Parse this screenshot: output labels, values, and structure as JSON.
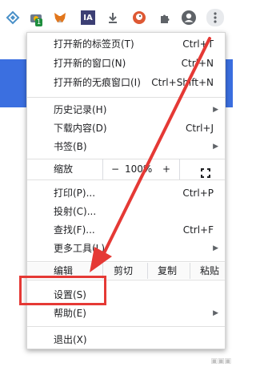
{
  "menu": {
    "items": [
      {
        "label": "打开新的标签页(T)",
        "shortcut": "Ctrl+T"
      },
      {
        "label": "打开新的窗口(N)",
        "shortcut": "Ctrl+N"
      },
      {
        "label": "打开新的无痕窗口(I)",
        "shortcut": "Ctrl+Shift+N"
      },
      {
        "label": "历史记录(H)",
        "arrow": "▶"
      },
      {
        "label": "下载内容(D)",
        "shortcut": "Ctrl+J"
      },
      {
        "label": "书签(B)",
        "arrow": "▶"
      },
      {
        "label": "打印(P)...",
        "shortcut": "Ctrl+P"
      },
      {
        "label": "投射(C)..."
      },
      {
        "label": "查找(F)...",
        "shortcut": "Ctrl+F"
      },
      {
        "label": "更多工具(L)",
        "arrow": "▶"
      },
      {
        "label": "设置(S)"
      },
      {
        "label": "帮助(E)",
        "arrow": "▶"
      },
      {
        "label": "退出(X)"
      }
    ],
    "zoom": {
      "label": "缩放",
      "minus": "−",
      "value": "100%",
      "plus": "+",
      "fullscreen_icon": "fullscreen-icon"
    },
    "edit": {
      "label": "编辑",
      "cut": "剪切",
      "copy": "复制",
      "paste": "粘贴"
    }
  },
  "toolbar": {
    "extension_badge": "1",
    "ia_label": "IA"
  },
  "colors": {
    "annotation": "#e53935",
    "page_band": "#3b6fe0"
  }
}
